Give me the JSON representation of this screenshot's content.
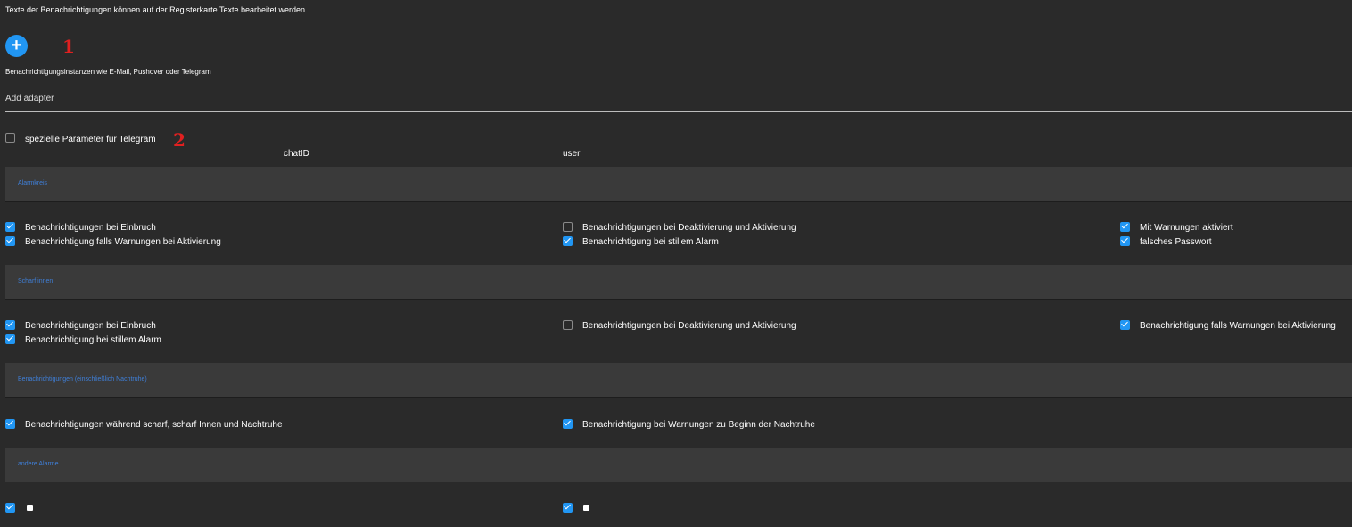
{
  "header": {
    "info_text": "Texte der Benachrichtigungen können auf der Registerkarte Texte bearbeitet werden",
    "add_button_label": "+",
    "marker_1": "1",
    "instances_hint": "Benachrichtigungsinstanzen wie E-Mail, Pushover oder Telegram",
    "adapter_label": "Add adapter"
  },
  "telegram": {
    "checkbox_label": "spezielle Parameter für Telegram",
    "checked": false,
    "marker_2": "2",
    "col_chatid": "chatID",
    "col_user": "user"
  },
  "sections": [
    {
      "title": "Alarmkreis",
      "items": [
        {
          "label": "Benachrichtigungen bei Einbruch",
          "checked": true
        },
        {
          "label": "Benachrichtigung falls Warnungen bei Aktivierung",
          "checked": true
        },
        {
          "label": "Benachrichtigungen bei Deaktivierung und Aktivierung",
          "checked": false
        },
        {
          "label": "Benachrichtigung bei stillem Alarm",
          "checked": true
        },
        {
          "label": "Mit Warnungen aktiviert",
          "checked": true
        },
        {
          "label": "falsches Passwort",
          "checked": true
        }
      ]
    },
    {
      "title": "Scharf innen",
      "items": [
        {
          "label": "Benachrichtigungen bei Einbruch",
          "checked": true
        },
        {
          "label": "Benachrichtigung bei stillem Alarm",
          "checked": true
        },
        {
          "label": "Benachrichtigungen bei Deaktivierung und Aktivierung",
          "checked": false
        },
        {
          "label": "Benachrichtigung falls Warnungen bei Aktivierung",
          "checked": true
        }
      ]
    },
    {
      "title": "Benachrichtigungen (einschließlich Nachtruhe)",
      "items": [
        {
          "label": "Benachrichtigungen während scharf, scharf Innen und Nachtruhe",
          "checked": true
        },
        {
          "label": "Benachrichtigung bei Warnungen zu Beginn der Nachtruhe",
          "checked": true
        }
      ]
    },
    {
      "title": "andere Alarme",
      "items": [
        {
          "icon": "small-square-icon",
          "checked": true
        },
        {
          "icon": "small-square-icon",
          "checked": true
        }
      ]
    }
  ],
  "colors": {
    "background": "#2a2a2a",
    "section_bg": "#3a3a3a",
    "accent": "#2196f3",
    "section_title": "#3f7fd8",
    "marker": "#e02020"
  }
}
